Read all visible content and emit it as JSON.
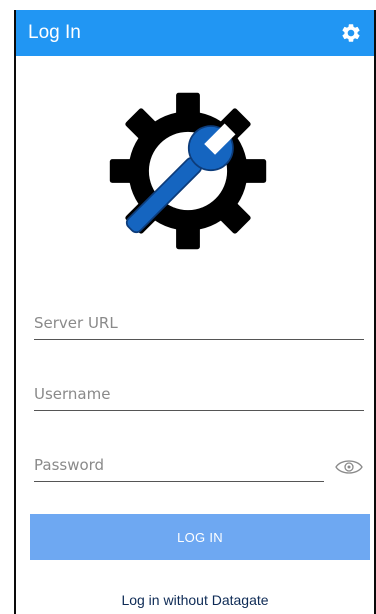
{
  "app_bar": {
    "title": "Log In",
    "settings_icon": "gear-icon",
    "background_color": "#2196f3"
  },
  "logo": {
    "icon": "gear-wrench-icon",
    "gear_color": "#000000",
    "wrench_color": "#1565c0"
  },
  "form": {
    "server_url": {
      "value": "",
      "placeholder": "Server URL"
    },
    "username": {
      "value": "",
      "placeholder": "Username"
    },
    "password": {
      "value": "",
      "placeholder": "Password",
      "toggle_icon": "eye-icon"
    }
  },
  "actions": {
    "login_label": "LOG IN",
    "login_color": "#6ea8f2",
    "alt_login_label": "Log in without Datagate"
  }
}
